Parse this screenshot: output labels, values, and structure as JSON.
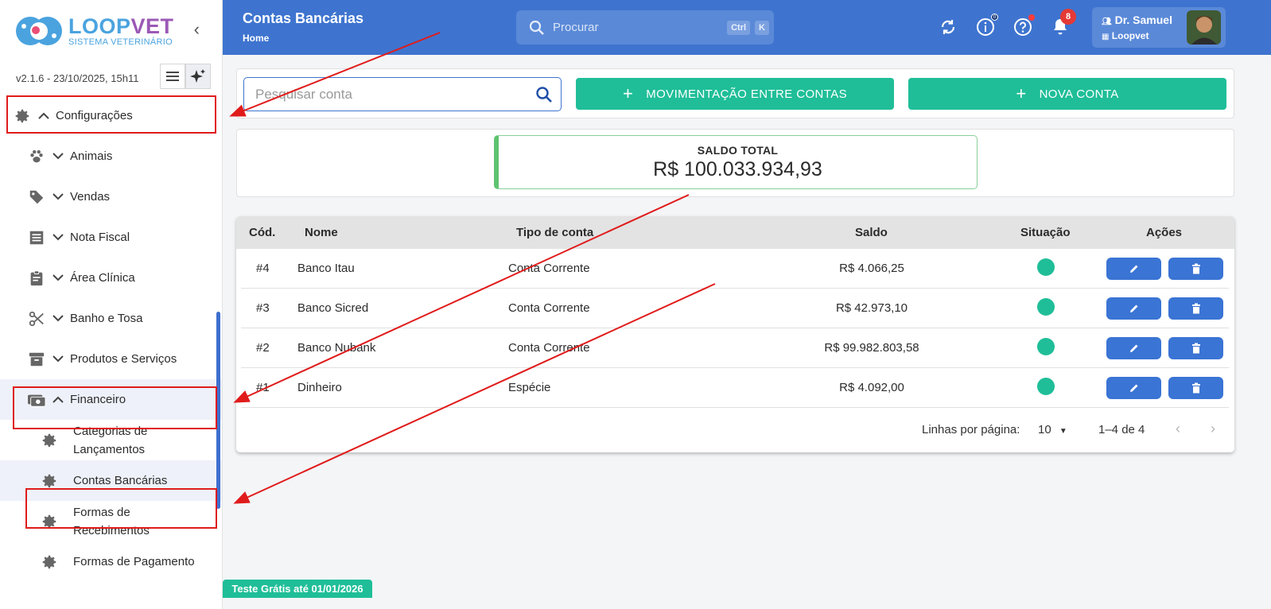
{
  "app": {
    "logo_title_a": "LOOP",
    "logo_title_b": "VET",
    "logo_subtitle": "SISTEMA VETERINÁRIO",
    "version": "v2.1.6 - 23/10/2025, 15h11",
    "colors": {
      "primary": "#3e74cf",
      "green": "#1fbe98",
      "danger": "#e01b1b"
    }
  },
  "sidebar": {
    "items": [
      {
        "label": "Configurações",
        "icon": "gear-icon"
      },
      {
        "label": "Animais",
        "icon": "paw-icon"
      },
      {
        "label": "Vendas",
        "icon": "tag-icon"
      },
      {
        "label": "Nota Fiscal",
        "icon": "receipt-icon"
      },
      {
        "label": "Área Clínica",
        "icon": "clipboard-icon"
      },
      {
        "label": "Banho e Tosa",
        "icon": "scissors-icon"
      },
      {
        "label": "Produtos e Serviços",
        "icon": "archive-icon"
      },
      {
        "label": "Financeiro",
        "icon": "money-icon"
      }
    ],
    "financeiro_sub": [
      {
        "label_line1": "Categorias de",
        "label_line2": "Lançamentos"
      },
      {
        "label_line1": "Contas Bancárias",
        "label_line2": ""
      },
      {
        "label_line1": "Formas de",
        "label_line2": "Recebimentos"
      },
      {
        "label_line1": "Formas de Pagamento",
        "label_line2": ""
      }
    ]
  },
  "header": {
    "title": "Contas Bancárias",
    "breadcrumb": "Home",
    "search_placeholder": "Procurar",
    "kbd_ctrl": "Ctrl",
    "kbd_k": "K",
    "notifications_count": "8",
    "info_badge": "0",
    "user_name": "Dr. Samuel",
    "user_org": "Loopvet"
  },
  "toolbar": {
    "search_placeholder": "Pesquisar conta",
    "transfer_label": "MOVIMENTAÇÃO ENTRE CONTAS",
    "new_label": "NOVA CONTA"
  },
  "saldo": {
    "label": "SALDO TOTAL",
    "value": "R$ 100.033.934,93"
  },
  "table": {
    "headers": {
      "cod": "Cód.",
      "nome": "Nome",
      "tipo": "Tipo de conta",
      "saldo": "Saldo",
      "situacao": "Situação",
      "acoes": "Ações"
    },
    "rows": [
      {
        "cod": "#4",
        "nome": "Banco Itau",
        "tipo": "Conta Corrente",
        "saldo": "R$ 4.066,25",
        "status_color": "#1fbe98"
      },
      {
        "cod": "#3",
        "nome": "Banco Sicred",
        "tipo": "Conta Corrente",
        "saldo": "R$ 42.973,10",
        "status_color": "#1fbe98"
      },
      {
        "cod": "#2",
        "nome": "Banco Nubank",
        "tipo": "Conta Corrente",
        "saldo": "R$ 99.982.803,58",
        "status_color": "#1fbe98"
      },
      {
        "cod": "#1",
        "nome": "Dinheiro",
        "tipo": "Espécie",
        "saldo": "R$ 4.092,00",
        "status_color": "#1fbe98"
      }
    ],
    "pager": {
      "rows_label": "Linhas por página:",
      "rows_value": "10",
      "range": "1–4 de 4"
    }
  },
  "trial": "Teste Grátis até 01/01/2026"
}
